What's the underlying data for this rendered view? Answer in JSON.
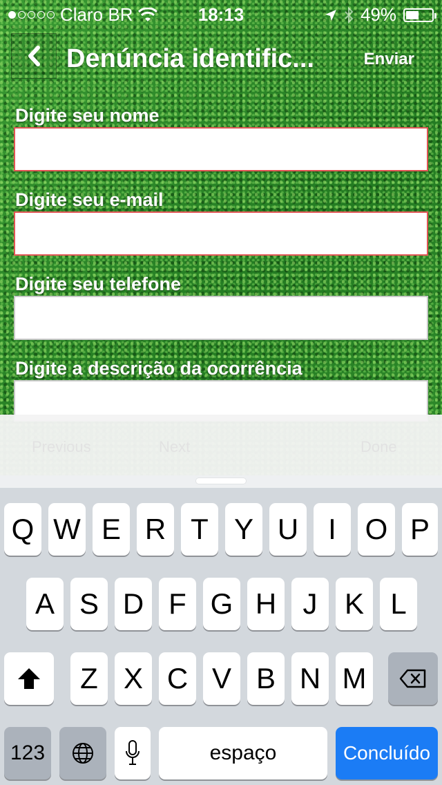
{
  "status_bar": {
    "carrier": "Claro BR",
    "time": "18:13",
    "battery": "49%",
    "battery_level": 0.49,
    "signal_bars_filled": 1,
    "signal_bars_total": 5
  },
  "nav": {
    "title": "Denúncia identific...",
    "back_icon": "chevron-left-icon",
    "send_label": "Enviar"
  },
  "form": {
    "name_label": "Digite seu nome",
    "email_label": "Digite seu e-mail",
    "phone_label": "Digite seu telefone",
    "description_label": "Digite a descrição da ocorrência"
  },
  "accessory": {
    "previous": "Previous",
    "next": "Next",
    "done": "Done"
  },
  "keyboard": {
    "row1": [
      "Q",
      "W",
      "E",
      "R",
      "T",
      "Y",
      "U",
      "I",
      "O",
      "P"
    ],
    "row2": [
      "A",
      "S",
      "D",
      "F",
      "G",
      "H",
      "J",
      "K",
      "L"
    ],
    "row3": [
      "Z",
      "X",
      "C",
      "V",
      "B",
      "N",
      "M"
    ],
    "numbers_label": "123",
    "space_label": "espaço",
    "done_label": "Concluído",
    "icons": [
      "shift-icon",
      "backspace-icon",
      "globe-icon",
      "microphone-icon"
    ]
  },
  "colors": {
    "accent": "#1b7cf5",
    "error_border": "#e05555",
    "grass": "#2e8a2a"
  }
}
